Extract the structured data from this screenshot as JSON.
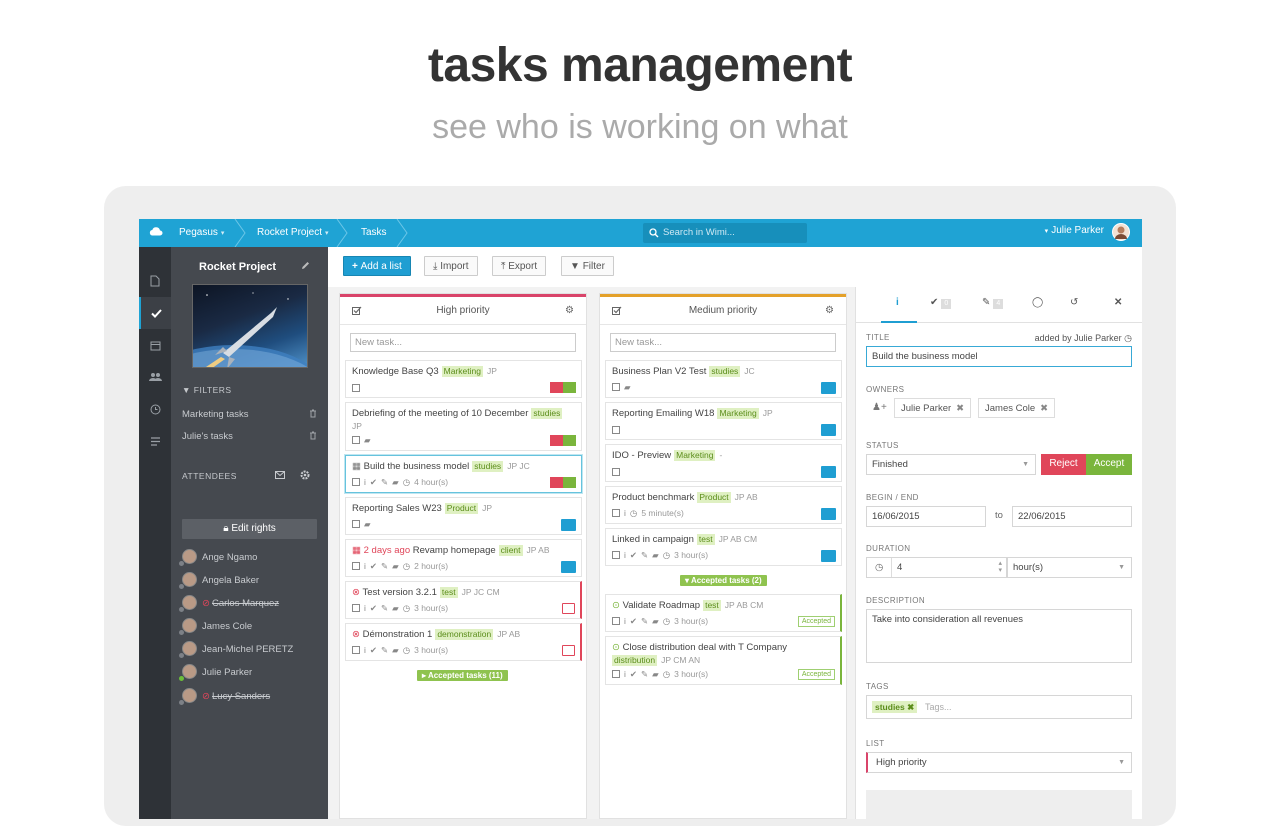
{
  "hero": {
    "title": "tasks management",
    "subtitle": "see who is working on what"
  },
  "topbar": {
    "crumbs": [
      {
        "label": "Pegasus",
        "caret": "▾"
      },
      {
        "label": "Rocket Project",
        "caret": "▾"
      },
      {
        "label": "Tasks",
        "caret": ""
      }
    ],
    "search_placeholder": "Search in Wimi...",
    "user_name": "Julie Parker",
    "user_caret": "▾",
    "accent": "#1fa3d4"
  },
  "leftpanel": {
    "project_title": "Rocket Project",
    "filters_label": "FILTERS",
    "filters": [
      "Marketing tasks",
      "Julie's tasks"
    ],
    "attendees_label": "ATTENDEES",
    "edit_rights": "Edit rights",
    "attendees": [
      {
        "name": "Ange Ngamo",
        "online": false,
        "removed": false
      },
      {
        "name": "Angela Baker",
        "online": false,
        "removed": false
      },
      {
        "name": "Carlos Marquez",
        "online": false,
        "removed": true
      },
      {
        "name": "James Cole",
        "online": false,
        "removed": false
      },
      {
        "name": "Jean-Michel PERETZ",
        "online": false,
        "removed": false
      },
      {
        "name": "Julie Parker",
        "online": true,
        "removed": false
      },
      {
        "name": "Lucy Sanders",
        "online": false,
        "removed": true
      }
    ]
  },
  "toolbar": {
    "add_list": "Add a list",
    "import": "Import",
    "export": "Export",
    "filter": "Filter"
  },
  "columns": [
    {
      "title": "High priority",
      "color": "#d9446a",
      "new_task": "New task...",
      "cards": [
        {
          "prefix": "",
          "title": "Knowledge Base Q3",
          "tag": "Marketing",
          "initials": "JP",
          "meta": "",
          "action": "thumbs"
        },
        {
          "prefix": "",
          "title": "Debriefing of the meeting of 10 December",
          "tag": "studies",
          "initials": "JP",
          "meta": "",
          "action": "thumbs"
        },
        {
          "prefix": "",
          "title": "Build the business model",
          "tag": "studies",
          "initials": "JP  JC",
          "meta": "4 hour(s)",
          "action": "thumbs"
        },
        {
          "prefix": "",
          "title": "Reporting Sales W23",
          "tag": "Product",
          "initials": "JP",
          "meta": "",
          "action": "check"
        },
        {
          "prefix": "2 days ago",
          "title": "Revamp homepage",
          "tag": "client",
          "initials": "JP  AB",
          "meta": "2 hour(s)",
          "action": "check"
        },
        {
          "prefix": "",
          "title": "Test version 3.2.1",
          "tag": "test",
          "initials": "JP  JC  CM",
          "meta": "3 hour(s)",
          "action": "redo"
        },
        {
          "prefix": "",
          "title": "Démonstration 1",
          "tag": "demonstration",
          "initials": "JP  AB",
          "meta": "3 hour(s)",
          "action": "redo"
        }
      ],
      "accepted": "Accepted tasks (11)"
    },
    {
      "title": "Medium priority",
      "color": "#e4a12a",
      "new_task": "New task...",
      "cards": [
        {
          "prefix": "",
          "title": "Business Plan V2 Test",
          "tag": "studies",
          "initials": "JC",
          "meta": "",
          "action": "check"
        },
        {
          "prefix": "",
          "title": "Reporting Emailing W18",
          "tag": "Marketing",
          "initials": "JP",
          "meta": "",
          "action": "check"
        },
        {
          "prefix": "",
          "title": "IDO - Preview",
          "tag": "Marketing",
          "initials": "-",
          "meta": "",
          "action": "check"
        },
        {
          "prefix": "",
          "title": "Product benchmark",
          "tag": "Product",
          "initials": "JP  AB",
          "meta": "5 minute(s)",
          "action": "check"
        },
        {
          "prefix": "",
          "title": "Linked in campaign",
          "tag": "test",
          "initials": "JP  AB  CM",
          "meta": "3 hour(s)",
          "action": "check"
        }
      ],
      "accepted": "Accepted tasks (2)",
      "accepted_cards": [
        {
          "title": "Validate Roadmap",
          "tag": "test",
          "initials": "JP  AB  CM",
          "meta": "3 hour(s)",
          "pill": "Accepted"
        },
        {
          "title": "Close distribution deal with T Company",
          "tag": "distribution",
          "initials": "JP  CM  AN",
          "meta": "3 hour(s)",
          "pill": "Accepted"
        }
      ]
    }
  ],
  "detail": {
    "tab_counts": {
      "checks": "0",
      "attachments": "4"
    },
    "title_label": "TITLE",
    "added_by": "added by Julie Parker",
    "title_value": "Build the business model",
    "owners_label": "OWNERS",
    "owners": [
      "Julie Parker",
      "James Cole"
    ],
    "status_label": "STATUS",
    "status_value": "Finished",
    "reject": "Reject",
    "accept": "Accept",
    "dates_label": "BEGIN / END",
    "begin": "16/06/2015",
    "to": "to",
    "end": "22/06/2015",
    "duration_label": "DURATION",
    "duration_value": "4",
    "duration_unit": "hour(s)",
    "description_label": "DESCRIPTION",
    "description": "Take into consideration all revenues",
    "tags_label": "TAGS",
    "tag": "studies",
    "tags_placeholder": "Tags...",
    "list_label": "LIST",
    "list_value": "High priority",
    "colors": {
      "reject": "#e0465a",
      "accept": "#7ab53c"
    }
  }
}
